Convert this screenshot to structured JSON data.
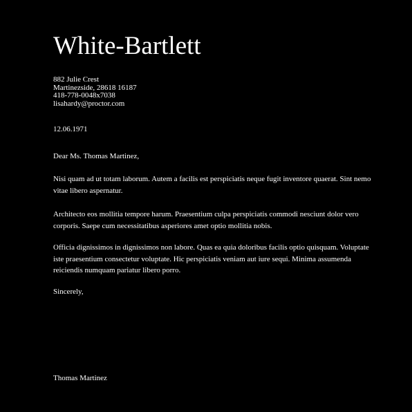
{
  "letter": {
    "company": "White-Bartlett",
    "address": {
      "street": "882 Julie Crest",
      "city_line": "Martinezside, 28618 16187",
      "phone": "418-778-0048x7038",
      "email": "lisahardy@proctor.com"
    },
    "date": "12.06.1971",
    "salutation": "Dear Ms. Thomas Martinez,",
    "paragraphs": [
      "Nisi quam ad ut totam laborum. Autem a facilis est perspiciatis neque fugit inventore quaerat. Sint nemo vitae libero aspernatur.",
      "Architecto eos mollitia tempore harum. Praesentium culpa perspiciatis commodi nesciunt dolor vero corporis. Saepe cum necessitatibus asperiores amet optio mollitia nobis.",
      "Officia dignissimos in dignissimos non labore. Quas ea quia doloribus facilis optio quisquam. Voluptate iste praesentium consectetur voluptate. Hic perspiciatis veniam aut iure sequi. Minima assumenda reiciendis numquam pariatur libero porro."
    ],
    "closing": "Sincerely,",
    "signature": "Thomas Martinez"
  },
  "colors": {
    "background": "#000000",
    "text": "#ffffff"
  }
}
